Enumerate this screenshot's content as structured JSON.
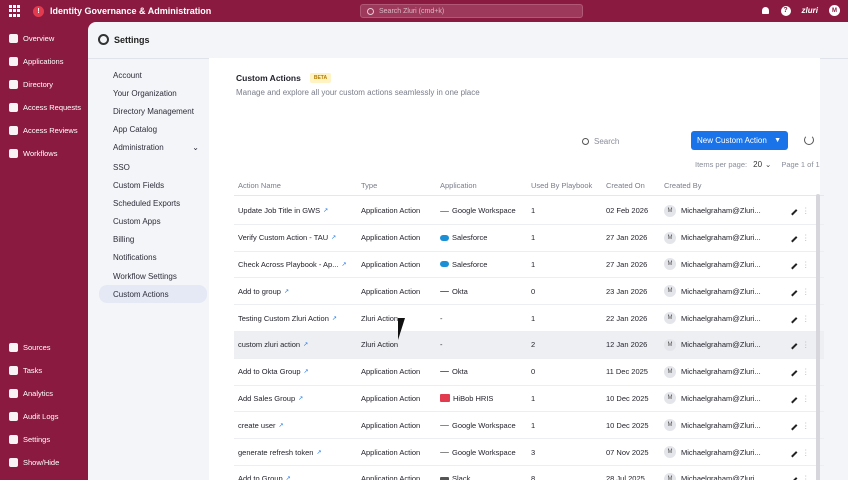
{
  "topbar": {
    "title": "Identity Governance & Administration",
    "search_placeholder": "Search Zluri (cmd+k)",
    "brand": "zluri",
    "avatar_initials": "M",
    "help": "?"
  },
  "leftnav": {
    "items": [
      {
        "label": "Overview",
        "icon": "grid-icon"
      },
      {
        "label": "Applications",
        "icon": "apps-icon"
      },
      {
        "label": "Directory",
        "icon": "folder-icon"
      },
      {
        "label": "Access Requests",
        "icon": "person-icon"
      },
      {
        "label": "Access Reviews",
        "icon": "shield-icon"
      },
      {
        "label": "Workflows",
        "icon": "bolt-icon"
      }
    ],
    "bottom_items": [
      {
        "label": "Sources",
        "icon": "sources-icon"
      },
      {
        "label": "Tasks",
        "icon": "tasks-icon"
      },
      {
        "label": "Analytics",
        "icon": "chart-icon"
      },
      {
        "label": "Audit Logs",
        "icon": "logs-icon"
      },
      {
        "label": "Settings",
        "icon": "gear-icon"
      },
      {
        "label": "Show/Hide",
        "icon": "toggle-icon"
      }
    ]
  },
  "settings": {
    "title": "Settings",
    "menu": [
      "Account",
      "Your Organization",
      "Directory Management",
      "App Catalog",
      "Administration",
      "SSO",
      "Custom Fields",
      "Scheduled Exports",
      "Custom Apps",
      "Billing",
      "Notifications",
      "Workflow Settings",
      "Custom Actions"
    ],
    "active": "Custom Actions"
  },
  "page": {
    "title": "Custom Actions",
    "badge": "BETA",
    "subtitle": "Manage and explore all your custom actions seamlessly in one place",
    "search_placeholder": "Search",
    "new_button": "New Custom Action",
    "items_per_page_label": "Items per page:",
    "items_per_page": "20",
    "page_info": "Page 1 of 1"
  },
  "table": {
    "headers": [
      "Action Name",
      "Type",
      "Application",
      "Used By Playbook",
      "Created On",
      "Created By"
    ],
    "rows": [
      {
        "name": "Update Job Title in GWS",
        "type": "Application Action",
        "app": "Google Workspace",
        "app_logo": "google",
        "used": "1",
        "created": "02 Feb 2026",
        "by": "Michaelgraham@Zluri..."
      },
      {
        "name": "Verify Custom Action - TAU",
        "type": "Application Action",
        "app": "Salesforce",
        "app_logo": "sf",
        "used": "1",
        "created": "27 Jan 2026",
        "by": "Michaelgraham@Zluri..."
      },
      {
        "name": "Check Across Playbook - Ap...",
        "type": "Application Action",
        "app": "Salesforce",
        "app_logo": "sf",
        "used": "1",
        "created": "27 Jan 2026",
        "by": "Michaelgraham@Zluri..."
      },
      {
        "name": "Add to group",
        "type": "Application Action",
        "app": "Okta",
        "app_logo": "okta",
        "used": "0",
        "created": "23 Jan 2026",
        "by": "Michaelgraham@Zluri..."
      },
      {
        "name": "Testing Custom Zluri Action",
        "type": "Zluri Action",
        "app": "-",
        "app_logo": "",
        "used": "1",
        "created": "22 Jan 2026",
        "by": "Michaelgraham@Zluri..."
      },
      {
        "name": "custom zluri action",
        "type": "Zluri Action",
        "app": "-",
        "app_logo": "",
        "used": "2",
        "created": "12 Jan 2026",
        "by": "Michaelgraham@Zluri..."
      },
      {
        "name": "Add to Okta Group",
        "type": "Application Action",
        "app": "Okta",
        "app_logo": "okta",
        "used": "0",
        "created": "11 Dec 2025",
        "by": "Michaelgraham@Zluri..."
      },
      {
        "name": "Add Sales Group",
        "type": "Application Action",
        "app": "HiBob HRIS",
        "app_logo": "hibob",
        "used": "1",
        "created": "10 Dec 2025",
        "by": "Michaelgraham@Zluri..."
      },
      {
        "name": "create user",
        "type": "Application Action",
        "app": "Google Workspace",
        "app_logo": "google",
        "used": "1",
        "created": "10 Dec 2025",
        "by": "Michaelgraham@Zluri..."
      },
      {
        "name": "generate refresh token",
        "type": "Application Action",
        "app": "Google Workspace",
        "app_logo": "google",
        "used": "3",
        "created": "07 Nov 2025",
        "by": "Michaelgraham@Zluri..."
      },
      {
        "name": "Add to Group",
        "type": "Application Action",
        "app": "Slack",
        "app_logo": "slack",
        "used": "8",
        "created": "28 Jul 2025",
        "by": "Michaelgraham@Zluri..."
      }
    ],
    "avatar_initial": "M",
    "highlighted_row": 5
  },
  "colors": {
    "brand": "#8b1a41",
    "primary_button": "#1a73e8"
  }
}
